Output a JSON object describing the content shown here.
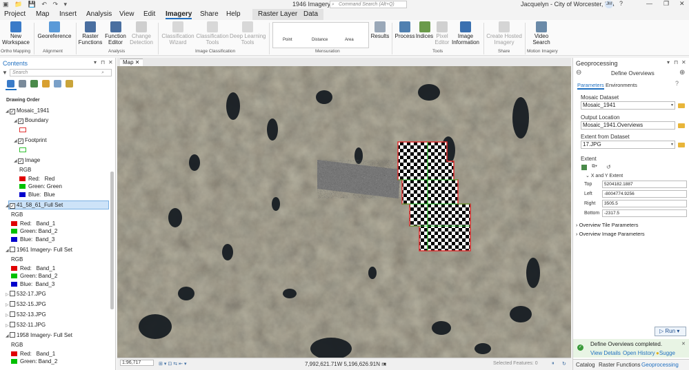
{
  "titlebar": {
    "quick_access": "▣ 📁 💾 ↶ ↷ ▾",
    "title": "1946 Imagery",
    "search_placeholder": "Command Search (Alt+Q)",
    "user": "Jacquelyn - City of Worcester, MA",
    "avatar": "JM",
    "help": "?",
    "minimize": "—",
    "maximize": "❐",
    "close": "✕"
  },
  "menu": {
    "items": [
      "Project",
      "Map",
      "Insert",
      "Analysis",
      "View",
      "Edit",
      "Imagery",
      "Share",
      "Help"
    ],
    "active": "Imagery",
    "context_tabs": [
      "Raster Layer",
      "Data"
    ]
  },
  "ribbon": {
    "buttons": {
      "new_workspace": "New\nWorkspace",
      "georeference": "Georeference",
      "raster_functions": "Raster\nFunctions",
      "function_editor": "Function\nEditor",
      "change_detection": "Change\nDetection",
      "classification_wizard": "Classification\nWizard",
      "classification_tools": "Classification\nTools",
      "deep_learning_tools": "Deep Learning\nTools",
      "results": "Results",
      "process": "Process",
      "indices": "Indices",
      "pixel_editor": "Pixel\nEditor",
      "image_information": "Image\nInformation",
      "create_hosted_imagery": "Create Hosted\nImagery",
      "video_search": "Video\nSearch"
    },
    "mensuration": {
      "point": "Point",
      "distance": "Distance",
      "area": "Area"
    },
    "groups": {
      "ortho": "Ortho Mapping",
      "alignment": "Alignment",
      "analysis": "Analysis",
      "classification": "Image Classification",
      "mensuration": "Mensuration",
      "tools": "Tools",
      "share": "Share",
      "motion": "Motion Imagery"
    }
  },
  "contents": {
    "title": "Contents",
    "search_placeholder": "Search",
    "drawing_order": "Drawing Order",
    "layers": {
      "mosaic": "Mosaic_1941",
      "boundary": "Boundary",
      "footprint": "Footprint",
      "image": "Image",
      "rgb": "RGB",
      "red_red": "Red:   Red",
      "green_green": "Green: Green",
      "blue_blue": "Blue:  Blue",
      "fullset_41": "41_58_61_Full Set",
      "red_b1": "Red:   Band_1",
      "green_b2": "Green: Band_2",
      "blue_b3": "Blue:  Band_3",
      "imagery_1961": "1961 Imagery- Full Set",
      "f17": "532-17.JPG",
      "f15": "532-15.JPG",
      "f13": "532-13.JPG",
      "f11": "532-11.JPG",
      "imagery_1958": "1958 Imagery- Full Set"
    }
  },
  "map": {
    "tab": "Map",
    "scale": "1:96,717",
    "coords": "7,992,621.71W 5,196,626.91N m",
    "selected": "Selected Features: 0"
  },
  "geoprocessing": {
    "title": "Geoprocessing",
    "tool": "Define Overviews",
    "tab_parameters": "Parameters",
    "tab_environments": "Environments",
    "mosaic_label": "Mosaic Dataset",
    "mosaic_value": "Mosaic_1941",
    "output_label": "Output Location",
    "output_value": "Mosaic_1941.Overviews",
    "extent_from_label": "Extent from Dataset",
    "extent_from_value": "17.JPG",
    "extent_label": "Extent",
    "xy_extent": "X and Y Extent",
    "top_label": "Top",
    "top_value": "5204182.1887",
    "left_label": "Left",
    "left_value": "-8004774.9256",
    "right_label": "Right",
    "right_value": "3505.5",
    "bottom_label": "Bottom",
    "bottom_value": "-2317.5",
    "overview_tile": "Overview Tile Parameters",
    "overview_image": "Overview Image Parameters",
    "run": "Run",
    "notice": "Define Overviews completed.",
    "view_details": "View Details",
    "open_history": "Open History",
    "suggest": "Sugge",
    "bottom_tabs": [
      "Catalog",
      "Raster Functions",
      "Geoprocessing"
    ]
  },
  "colors": {
    "accent": "#1f6fc0",
    "swatch_red": "#e00000",
    "swatch_green": "#00c000",
    "swatch_blue": "#0000cc",
    "boundary_outline": "#e03030",
    "footprint_outline": "#30c030"
  }
}
